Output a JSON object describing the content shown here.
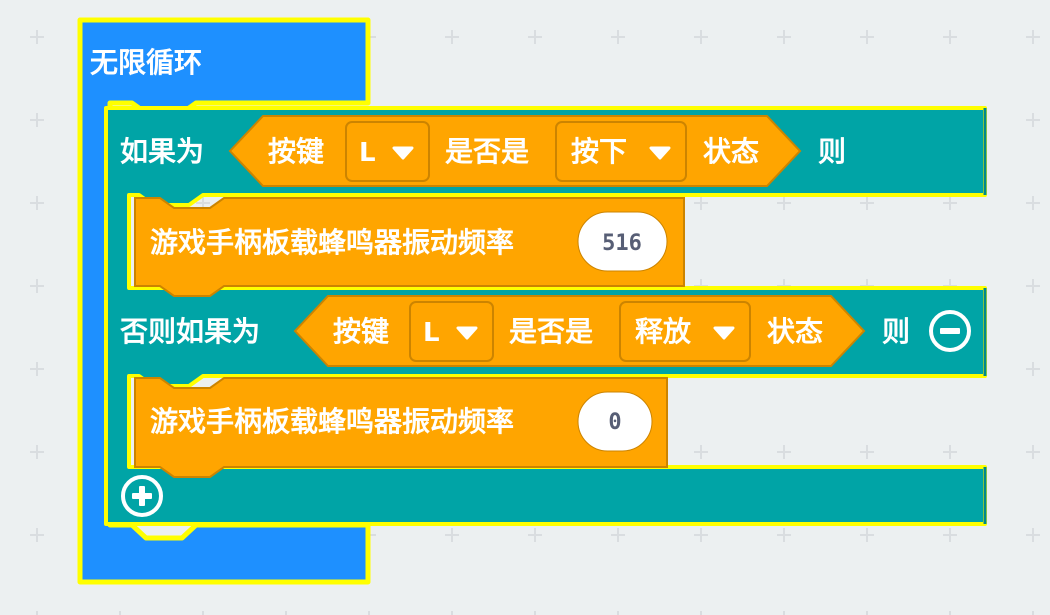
{
  "colors": {
    "workspace": "#ecf0f1",
    "loop_block": "#1e90ff",
    "selection_outline": "#ffff00",
    "if_block": "#00a4a6",
    "gamepad_block": "#ffa500",
    "gamepad_block_border": "#cc8400",
    "number_field": "#ffffff",
    "number_text": "#575e75"
  },
  "forever_block": {
    "label": "无限循环"
  },
  "if_block": {
    "if_label": "如果为",
    "then_label": "则",
    "else_if_label": "否则如果为",
    "remove_icon": "minus-circle-icon",
    "add_icon": "plus-circle-icon",
    "conditions": [
      {
        "key_label": "按键",
        "key_value": "L",
        "is_label": "是否是",
        "state_value": "按下",
        "state_label": "状态"
      },
      {
        "key_label": "按键",
        "key_value": "L",
        "is_label": "是否是",
        "state_value": "释放",
        "state_label": "状态"
      }
    ],
    "statements": [
      {
        "label": "游戏手柄板载蜂鸣器振动频率",
        "value": "516"
      },
      {
        "label": "游戏手柄板载蜂鸣器振动频率",
        "value": "0"
      }
    ]
  }
}
